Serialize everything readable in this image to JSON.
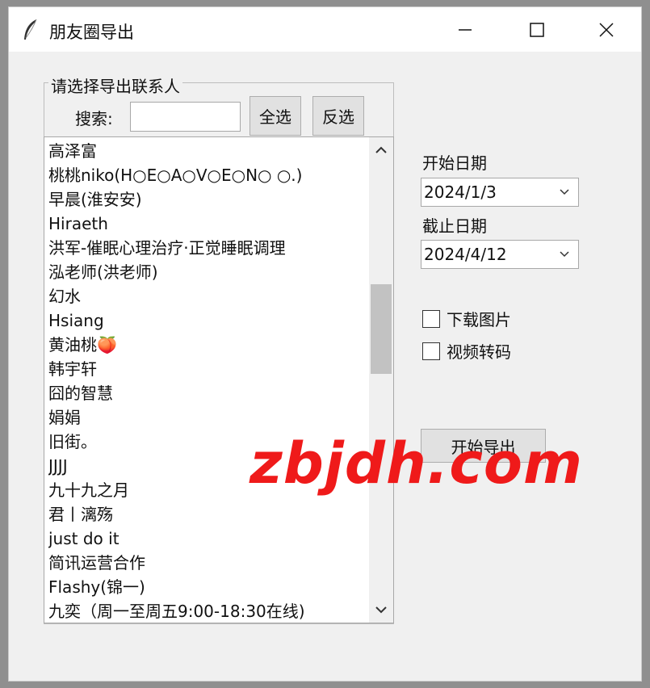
{
  "window": {
    "title": "朋友圈导出"
  },
  "contacts": {
    "group_label": "请选择导出联系人",
    "search_label": "搜索:",
    "search_value": "",
    "select_all_label": "全选",
    "invert_label": "反选",
    "items": [
      "高泽富",
      "桃桃niko(H○E○A○V○E○N○ ○.)",
      "早晨(淮安安)",
      "Hiraeth",
      "洪军-催眠心理治疗·正觉睡眠调理",
      "泓老师(洪老师)",
      "幻水",
      "Hsiang",
      "黄油桃🍑",
      "韩宇轩",
      "囧的智慧",
      "娟娟",
      "旧街。",
      "JJJJ",
      "九十九之月",
      "君丨漓殇",
      "just do it",
      "简讯运营合作",
      "Flashy(锦一)",
      "九奕（周一至周五9:00-18:30在线)"
    ]
  },
  "dates": {
    "start_label": "开始日期",
    "start_value": "2024/1/3",
    "end_label": "截止日期",
    "end_value": "2024/4/12"
  },
  "options": {
    "download_images_label": "下载图片",
    "download_images_checked": false,
    "transcode_video_label": "视频转码",
    "transcode_video_checked": false
  },
  "export_button_label": "开始导出",
  "watermark": "zbjdh.com"
}
